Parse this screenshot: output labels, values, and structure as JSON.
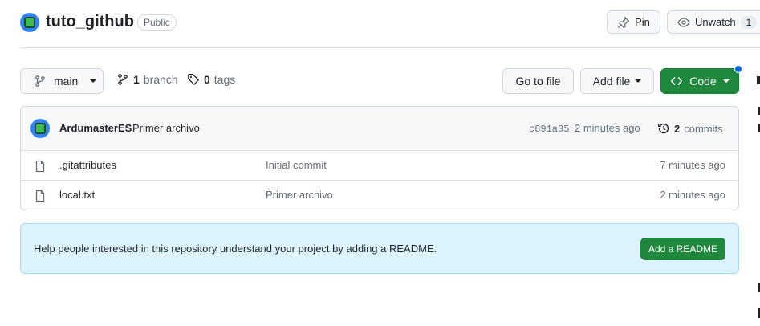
{
  "repo": {
    "name": "tuto_github",
    "visibility": "Public",
    "pin_label": "Pin",
    "watch_label": "Unwatch",
    "watch_count": "1"
  },
  "toolbar": {
    "branch_name": "main",
    "branches_count": "1",
    "branches_label": "branch",
    "tags_count": "0",
    "tags_label": "tags",
    "go_to_file": "Go to file",
    "add_file": "Add file",
    "code": "Code"
  },
  "latest_commit": {
    "author": "ArdumasterES",
    "message": "Primer archivo",
    "hash": "c891a35",
    "time": "2 minutes ago",
    "commits_count": "2",
    "commits_label": "commits"
  },
  "files": [
    {
      "name": ".gitattributes",
      "message": "Initial commit",
      "time": "7 minutes ago"
    },
    {
      "name": "local.txt",
      "message": "Primer archivo",
      "time": "2 minutes ago"
    }
  ],
  "readme_banner": {
    "text": "Help people interested in this repository understand your project by adding a README.",
    "button": "Add a README"
  },
  "colors": {
    "green": "#1f883d",
    "banner_bg": "#ddf4ff",
    "blue_dot": "#0969da"
  }
}
